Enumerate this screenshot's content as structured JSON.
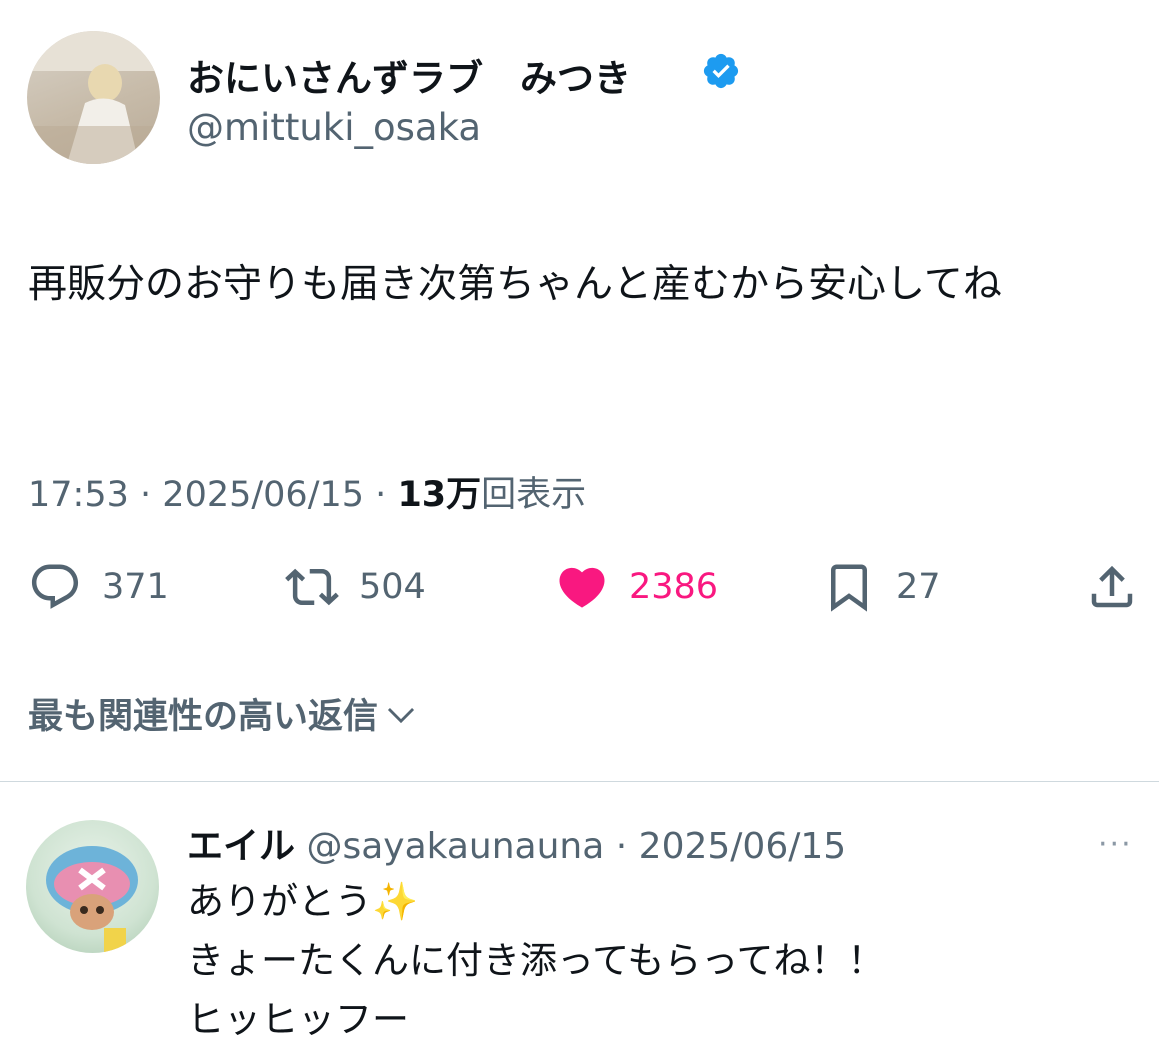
{
  "tweet": {
    "display_name": "おにいさんずラブ　みつき",
    "handle": "@mittuki_osaka",
    "text": "再販分のお守りも届き次第ちゃんと産むから安心してね",
    "time": "17:53",
    "date": "2025/06/15",
    "views_count": "13万",
    "views_label": "回表示",
    "separator": "·",
    "colors": {
      "verified": "#1d9bf0",
      "like": "#f91880",
      "muted": "#536471"
    }
  },
  "actions": {
    "reply_count": "371",
    "retweet_count": "504",
    "like_count": "2386",
    "bookmark_count": "27"
  },
  "replies_sort": {
    "label": "最も関連性の高い返信"
  },
  "reply": {
    "name": "エイル",
    "handle": "@sayakaunauna",
    "separator": "·",
    "date": "2025/06/15",
    "more": "···",
    "lines": [
      "ありがとう✨",
      "きょーたくんに付き添ってもらってね！！",
      "ヒッヒッフー"
    ]
  }
}
